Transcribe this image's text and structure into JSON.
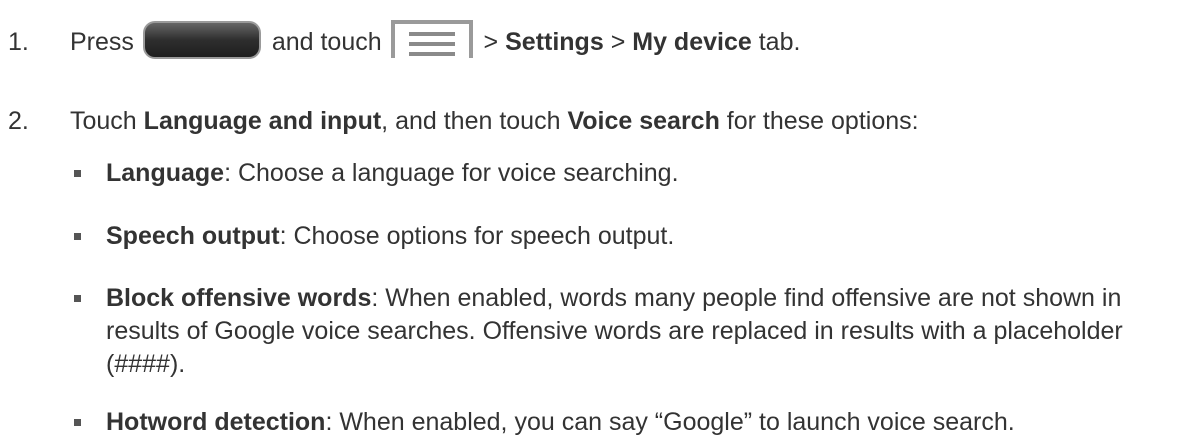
{
  "steps": [
    {
      "number": "1.",
      "press": "Press",
      "and_touch": "and touch",
      "sep1": ">",
      "settings": "Settings",
      "sep2": ">",
      "my_device": "My device",
      "tab": "tab."
    },
    {
      "number": "2.",
      "touch": "Touch",
      "language_and_input": "Language and input",
      "and_then_touch": ", and then touch",
      "voice_search": "Voice search",
      "for_options": "for these options:"
    }
  ],
  "icons": {
    "home_key": "home-key-icon",
    "menu_key": "menu-icon"
  },
  "options": [
    {
      "term": "Language",
      "desc": ": Choose a language for voice searching."
    },
    {
      "term": "Speech output",
      "desc": ": Choose options for speech output."
    },
    {
      "term": "Block offensive words",
      "desc": ": When enabled, words many people find offensive are not shown in results of Google voice searches. Offensive words are replaced in results with a placeholder (####)."
    },
    {
      "term": "Hotword detection",
      "desc": ": When enabled, you can say “Google” to launch voice search."
    }
  ]
}
